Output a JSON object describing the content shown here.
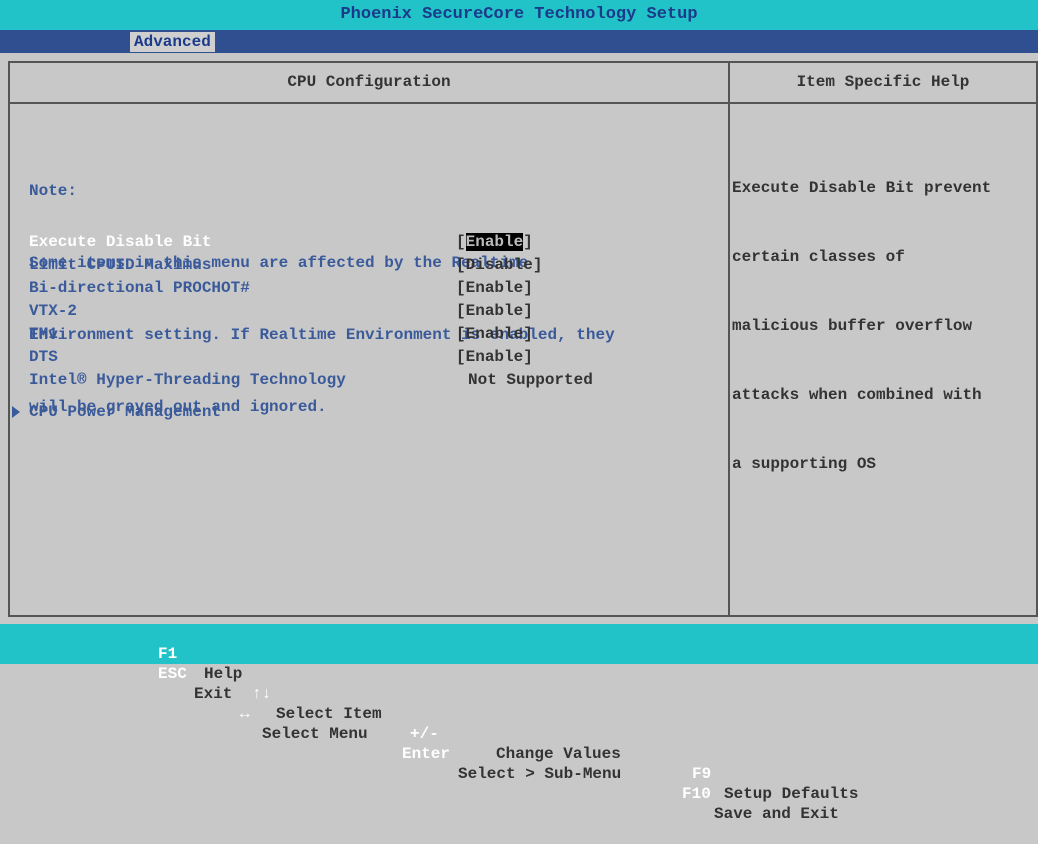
{
  "title": "Phoenix SecureCore Technology Setup",
  "menu": {
    "active_tab": "Advanced"
  },
  "panel": {
    "heading": "CPU Configuration",
    "help_heading": "Item Specific Help",
    "note_lines": [
      "Note:",
      "Some items in this menu are affected by the Realtime",
      "Environment setting. If Realtime Environment is enabled, they",
      "will be grayed out and ignored."
    ],
    "items": [
      {
        "label": "Execute Disable Bit",
        "value": "Enable",
        "selected": true
      },
      {
        "label": "Limit CPUID Maximus",
        "value": "Disable"
      },
      {
        "label": "Bi-directional PROCHOT#",
        "value": "Enable"
      },
      {
        "label": "VTX-2",
        "value": "Enable"
      },
      {
        "label": "TM1",
        "value": "Enable"
      },
      {
        "label": "DTS",
        "value": "Enable"
      },
      {
        "label": "Intel® Hyper-Threading Technology",
        "value_plain": "Not Supported"
      }
    ],
    "submenu": "CPU Power Management",
    "help_lines": [
      "Execute Disable Bit prevent",
      "certain classes of",
      "malicious buffer overflow",
      "attacks when combined with",
      "a supporting OS"
    ]
  },
  "footer": {
    "row1": [
      {
        "key": "F1",
        "text": "Help"
      },
      {
        "key": "↑↓",
        "text": "Select Item"
      },
      {
        "key": "+/-",
        "text": "Change Values"
      },
      {
        "key": "F9",
        "text": "Setup Defaults"
      }
    ],
    "row2": [
      {
        "key": "ESC",
        "text": "Exit"
      },
      {
        "key": "↔",
        "text": "Select Menu"
      },
      {
        "key": "Enter",
        "text": "Select > Sub-Menu"
      },
      {
        "key": "F10",
        "text": "Save and Exit"
      }
    ]
  }
}
